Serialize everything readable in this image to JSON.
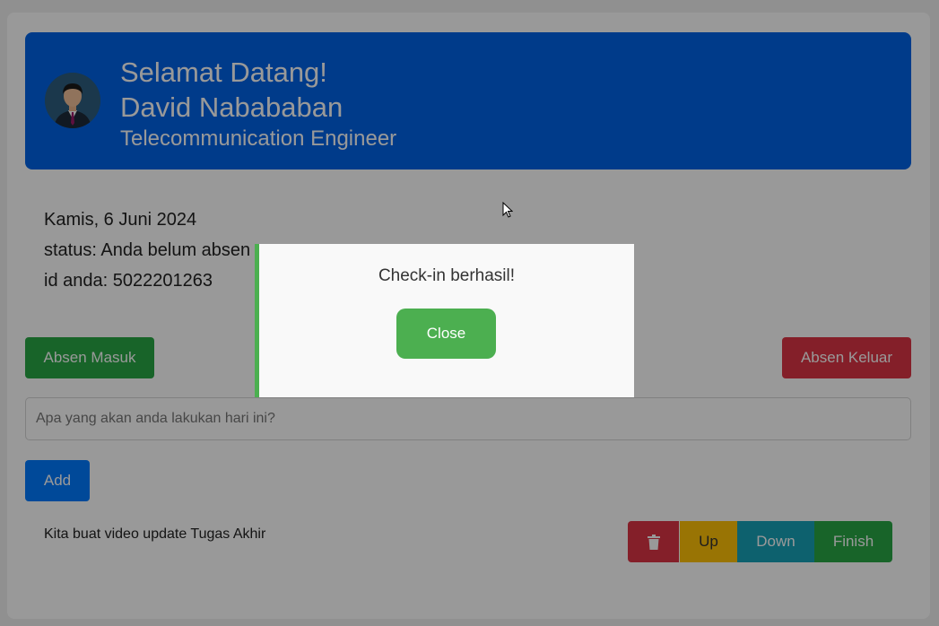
{
  "header": {
    "welcome": "Selamat Datang!",
    "name": "David Nabababan",
    "role": "Telecommunication Engineer"
  },
  "info": {
    "date": "Kamis, 6 Juni 2024",
    "status": "status: Anda belum absen",
    "id": "id anda: 5022201263"
  },
  "actions": {
    "check_in": "Absen Masuk",
    "check_out": "Absen Keluar"
  },
  "task_input": {
    "placeholder": "Apa yang akan anda lakukan hari ini?",
    "value": ""
  },
  "add_label": "Add",
  "tasks": [
    {
      "text": "Kita buat video update Tugas Akhir",
      "delete_icon": "trash-icon",
      "up_label": "Up",
      "down_label": "Down",
      "finish_label": "Finish"
    }
  ],
  "modal": {
    "message": "Check-in berhasil!",
    "close_label": "Close"
  },
  "colors": {
    "primary": "#0063e6",
    "success": "#28a745",
    "danger": "#dc3545",
    "warning": "#ffc107",
    "info": "#17a2b8",
    "modal_accent": "#4caf50"
  }
}
